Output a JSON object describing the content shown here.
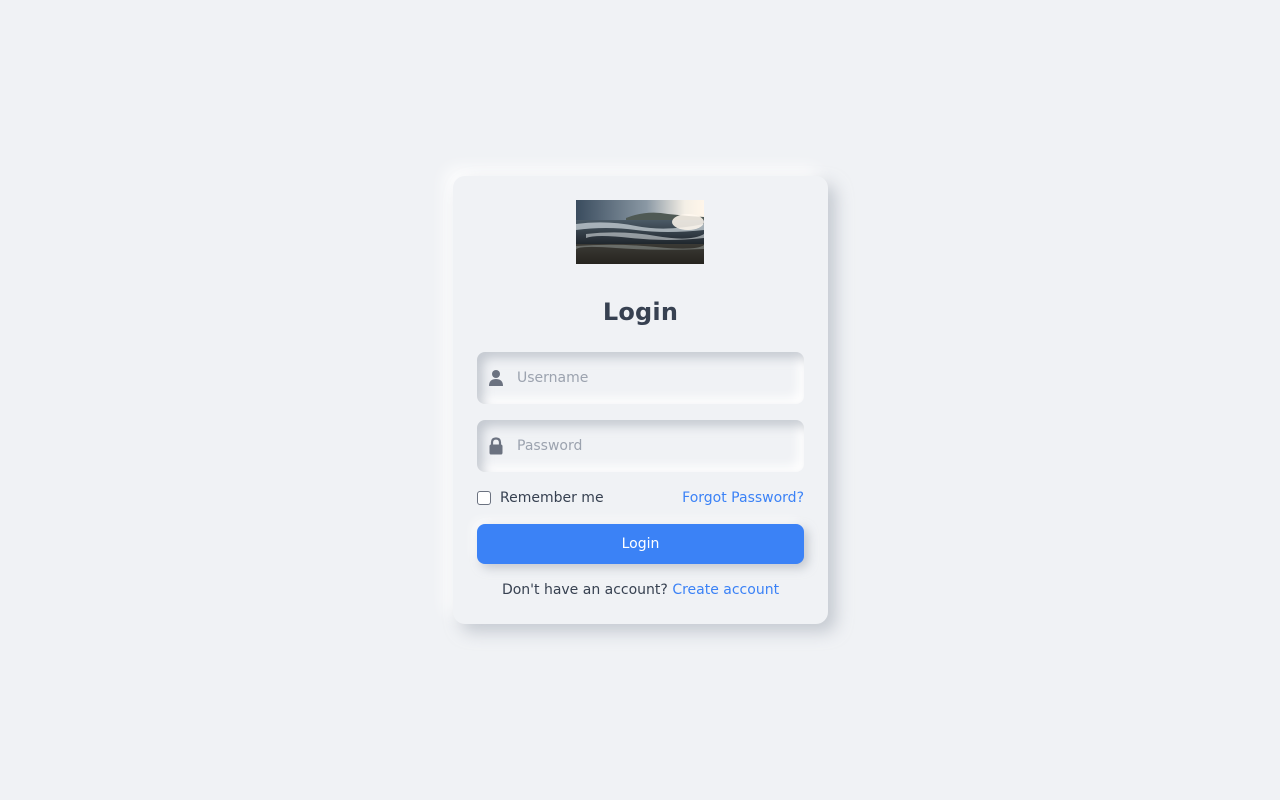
{
  "login": {
    "title": "Login",
    "username_placeholder": "Username",
    "password_placeholder": "Password",
    "remember_label": "Remember me",
    "remember_checked": false,
    "forgot_label": "Forgot Password?",
    "submit_label": "Login",
    "signup_prompt": "Don't have an account?",
    "signup_link": "Create account"
  },
  "icons": {
    "username": "user-icon",
    "password": "lock-icon"
  },
  "colors": {
    "background": "#f0f2f5",
    "accent": "#3b82f6",
    "text": "#374151",
    "placeholder": "#9ca3af",
    "icon": "#6b7280"
  }
}
